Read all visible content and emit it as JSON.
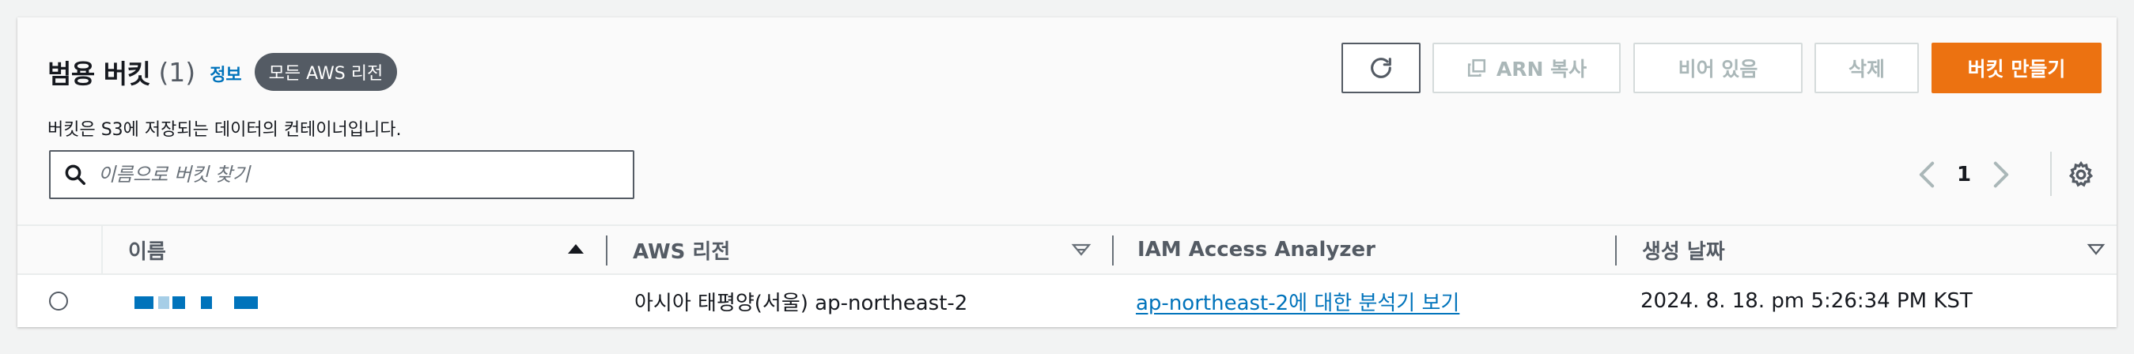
{
  "header": {
    "title": "범용 버킷",
    "count": "(1)",
    "info_link": "정보",
    "region_badge": "모든 AWS 리전",
    "description": "버킷은 S3에 저장되는 데이터의 컨테이너입니다."
  },
  "toolbar": {
    "refresh_icon": "refresh-icon",
    "copy_arn_label": "ARN 복사",
    "copy_icon": "copy-icon",
    "empty_label": "비어 있음",
    "delete_label": "삭제",
    "create_label": "버킷 만들기"
  },
  "search": {
    "placeholder": "이름으로 버킷 찾기",
    "value": ""
  },
  "pagination": {
    "current_page": "1"
  },
  "table": {
    "columns": [
      "이름",
      "AWS 리전",
      "IAM Access Analyzer",
      "생성 날짜"
    ],
    "rows": [
      {
        "name": "",
        "region": "아시아 태평양(서울) ap-northeast-2",
        "analyzer": "ap-northeast-2에 대한 분석기 보기",
        "created": "2024. 8. 18. pm 5:26:34 PM KST"
      }
    ]
  },
  "colors": {
    "primary_button": "#ec7211",
    "link": "#0073bb",
    "badge": "#545b64"
  }
}
